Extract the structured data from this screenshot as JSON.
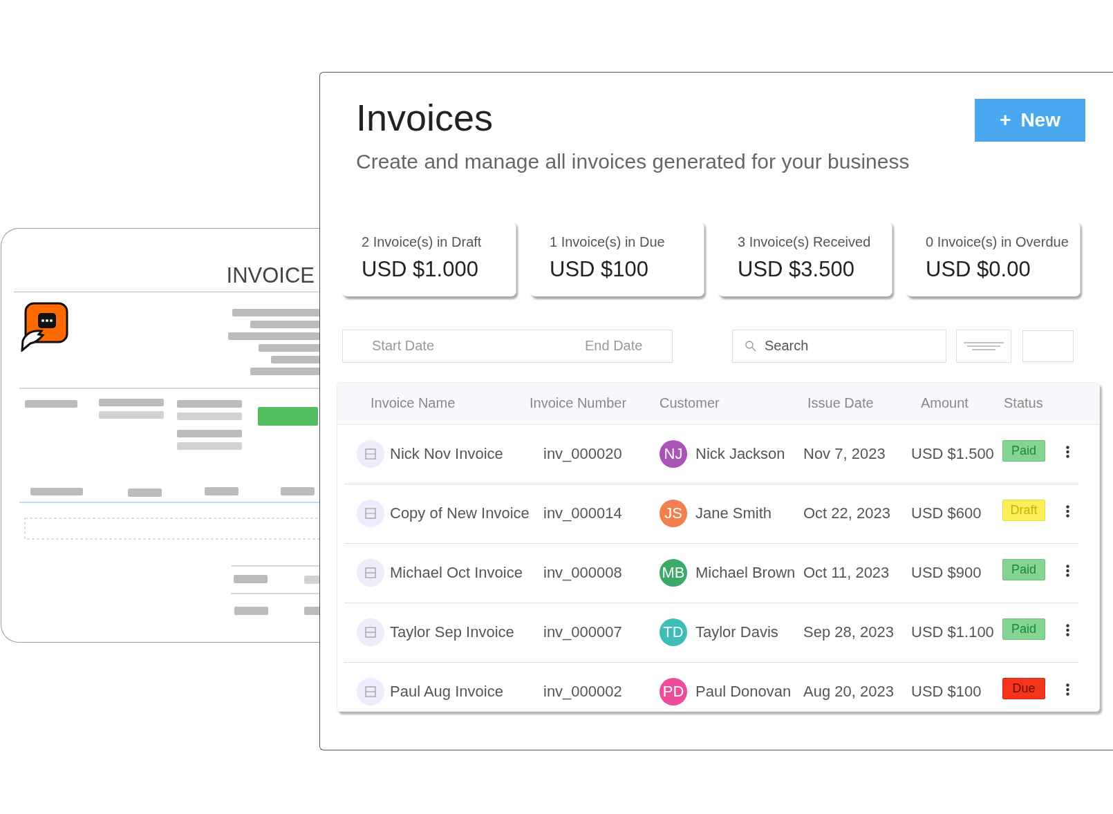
{
  "preview": {
    "title": "INVOICE"
  },
  "header": {
    "title": "Invoices",
    "subtitle": "Create and manage all invoices generated for your business",
    "new_button": {
      "icon": "+",
      "label": "New"
    }
  },
  "stats": [
    {
      "label": "2 Invoice(s) in Draft",
      "value": "USD $1.000"
    },
    {
      "label": "1 Invoice(s) in Due",
      "value": "USD $100"
    },
    {
      "label": "3 Invoice(s) Received",
      "value": "USD $3.500"
    },
    {
      "label": "0 Invoice(s) in Overdue",
      "value": "USD $0.00"
    }
  ],
  "filters": {
    "start_date": {
      "placeholder": "Start Date"
    },
    "end_date": {
      "placeholder": "End Date"
    },
    "search": {
      "placeholder": "Search"
    }
  },
  "table": {
    "columns": [
      "Invoice Name",
      "Invoice Number",
      "Customer",
      "Issue Date",
      "Amount",
      "Status"
    ],
    "rows": [
      {
        "name": "Nick Nov Invoice",
        "number": "inv_000020",
        "initials": "NJ",
        "color": "#a855b5",
        "customer": "Nick Jackson",
        "date": "Nov 7, 2023",
        "amount": "USD $1.500",
        "status": "Paid",
        "kind": "paid"
      },
      {
        "name": "Copy of New Invoice",
        "number": "inv_000014",
        "initials": "JS",
        "color": "#f08050",
        "customer": "Jane Smith",
        "date": "Oct 22, 2023",
        "amount": "USD $600",
        "status": "Draft",
        "kind": "draft"
      },
      {
        "name": "Michael Oct Invoice",
        "number": "inv_000008",
        "initials": "MB",
        "color": "#3aa96a",
        "customer": "Michael Brown",
        "date": "Oct 11, 2023",
        "amount": "USD $900",
        "status": "Paid",
        "kind": "paid"
      },
      {
        "name": "Taylor Sep Invoice",
        "number": "inv_000007",
        "initials": "TD",
        "color": "#3dbdb5",
        "customer": "Taylor Davis",
        "date": "Sep 28, 2023",
        "amount": "USD $1.100",
        "status": "Paid",
        "kind": "paid"
      },
      {
        "name": "Paul Aug Invoice",
        "number": "inv_000002",
        "initials": "PD",
        "color": "#ee4d9b",
        "customer": "Paul Donovan",
        "date": "Aug 20, 2023",
        "amount": "USD $100",
        "status": "Due",
        "kind": "due"
      }
    ]
  }
}
